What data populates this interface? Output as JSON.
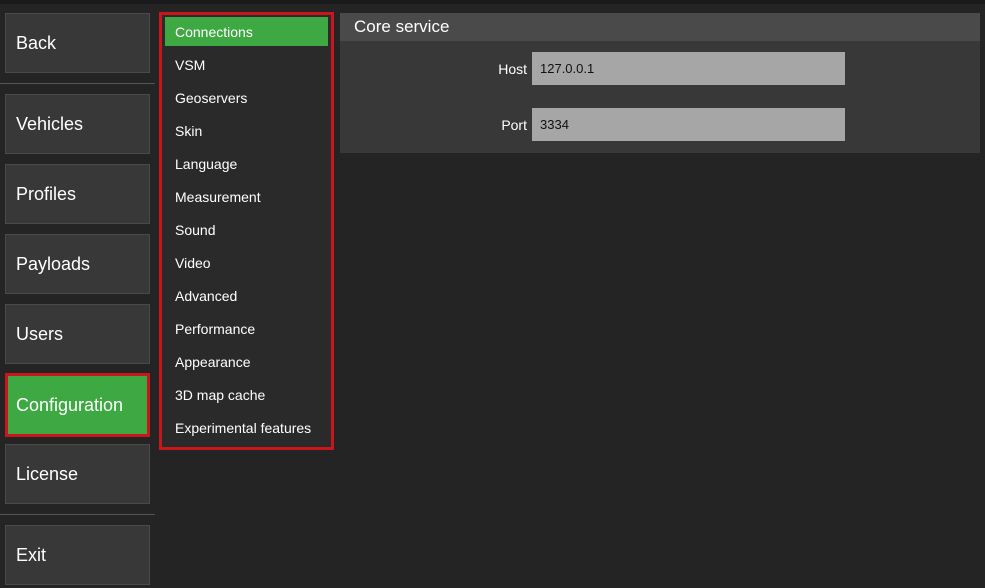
{
  "nav": {
    "back": "Back",
    "items": [
      {
        "label": "Vehicles"
      },
      {
        "label": "Profiles"
      },
      {
        "label": "Payloads"
      },
      {
        "label": "Users"
      },
      {
        "label": "Configuration",
        "active": true
      },
      {
        "label": "License"
      }
    ],
    "exit": "Exit"
  },
  "submenu": {
    "items": [
      {
        "label": "Connections",
        "active": true
      },
      {
        "label": "VSM"
      },
      {
        "label": "Geoservers"
      },
      {
        "label": "Skin"
      },
      {
        "label": "Language"
      },
      {
        "label": "Measurement"
      },
      {
        "label": "Sound"
      },
      {
        "label": "Video"
      },
      {
        "label": "Advanced"
      },
      {
        "label": "Performance"
      },
      {
        "label": "Appearance"
      },
      {
        "label": "3D map cache"
      },
      {
        "label": "Experimental features"
      }
    ]
  },
  "panel": {
    "title": "Core service",
    "host_label": "Host",
    "host_value": "127.0.0.1",
    "port_label": "Port",
    "port_value": "3334"
  },
  "colors": {
    "accent_green": "#3ea843",
    "highlight_red": "#c8161c",
    "background": "#242424"
  }
}
